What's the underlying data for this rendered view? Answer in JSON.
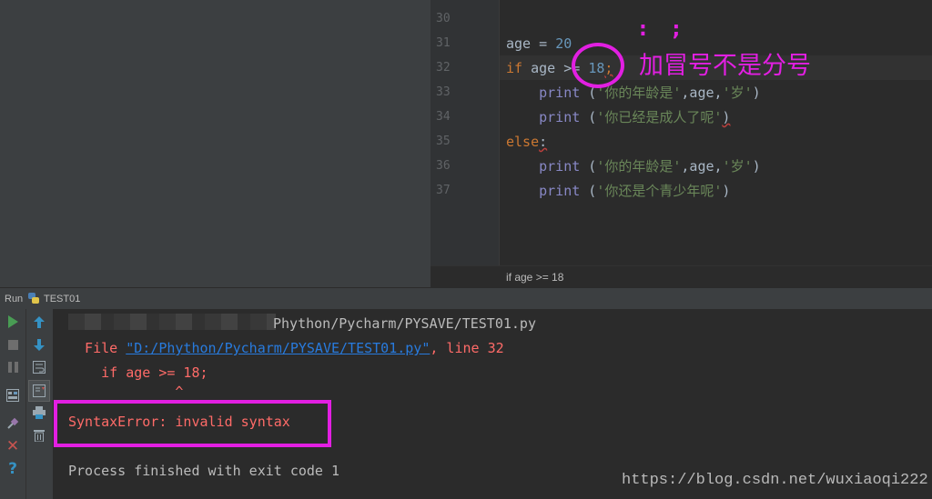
{
  "editor": {
    "line_numbers": [
      "30",
      "31",
      "32",
      "33",
      "34",
      "35",
      "36",
      "37"
    ],
    "lines": {
      "l31": {
        "name": "age",
        "op": " = ",
        "value": "20"
      },
      "l32": {
        "kw": "if",
        "rest": " age >= ",
        "value": "18",
        "semi": ";"
      },
      "l33": {
        "fn": "print",
        "open": " (",
        "str1": "'你的年龄是'",
        "comma": ",age,",
        "str2": "'岁'",
        "close": ")"
      },
      "l34": {
        "fn": "print",
        "open": " (",
        "str1": "'你已经是成人了呢'",
        "close": ")"
      },
      "l35": {
        "kw": "else",
        "colon": ":"
      },
      "l36": {
        "fn": "print",
        "open": " (",
        "str1": "'你的年龄是'",
        "comma": ",age,",
        "str2": "'岁'",
        "close": ")"
      },
      "l37": {
        "fn": "print",
        "open": " (",
        "str1": "'你还是个青少年呢'",
        "close": ")"
      }
    },
    "breadcrumb": "if age >= 18"
  },
  "annotation": {
    "symbols": ": ;",
    "text": "加冒号不是分号",
    "color": "#e21fe2"
  },
  "run": {
    "label": "Run",
    "config": "TEST01"
  },
  "console": {
    "path_tail": "Phython/Pycharm/PYSAVE/TEST01.py",
    "file_prefix": "  File ",
    "file_link": "\"D:/Phython/Pycharm/PYSAVE/TEST01.py\"",
    "file_suffix": ", line 32",
    "code_line": "    if age >= 18;",
    "caret": "             ^",
    "error": "SyntaxError: invalid syntax",
    "finished": "Process finished with exit code 1"
  },
  "watermark": "https://blog.csdn.net/wuxiaoqi222",
  "icons": {
    "left_toolbar": [
      "run-icon",
      "stop-icon",
      "pause-icon",
      "layout-icon",
      "pin-icon",
      "close-icon",
      "help-icon"
    ],
    "right_toolbar": [
      "up-arrow-icon",
      "down-arrow-icon",
      "soft-wrap-icon",
      "scroll-to-end-icon",
      "print-icon",
      "trash-icon"
    ]
  }
}
